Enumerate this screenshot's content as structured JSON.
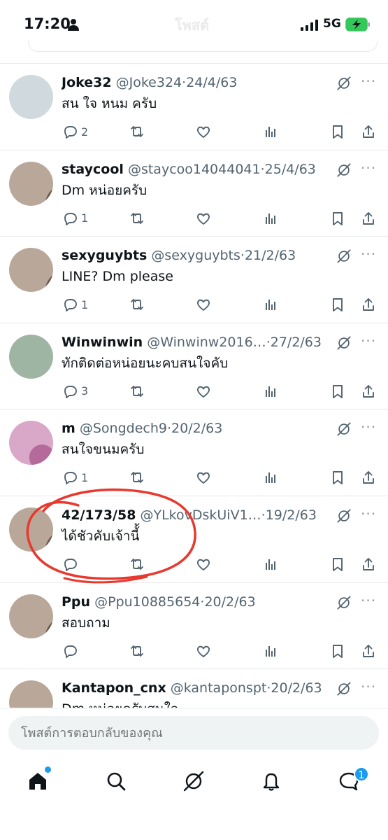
{
  "status_bar": {
    "time": "17:20",
    "network": "5G",
    "faded_title": "โพสต์"
  },
  "colors": {
    "accent": "#1d9bf0",
    "text": "#0f1419",
    "muted": "#536471",
    "annotation": "#e8392f",
    "battery": "#34c759"
  },
  "tweets": [
    {
      "name": "Joke32",
      "handle": "@Joke324",
      "date": "24/4/63",
      "text": "สน ใจ หนม ครับ",
      "replies": "2",
      "avatar": "default-avatar"
    },
    {
      "name": "staycool",
      "handle": "@staycoo14044041",
      "date": "25/4/63",
      "text": "Dm หน่อยครับ",
      "replies": "1",
      "avatar": "photo-avatar"
    },
    {
      "name": "sexyguybts",
      "handle": "@sexyguybts",
      "date": "21/2/63",
      "text": "LINE? Dm please",
      "replies": "1",
      "avatar": "photo-avatar"
    },
    {
      "name": "Winwinwin",
      "handle": "@Winwinw2016…",
      "date": "27/2/63",
      "text": "ทักติดต่อหน่อยนะคบสนใจคับ",
      "replies": "3",
      "avatar": "landscape-avatar"
    },
    {
      "name": "m",
      "handle": "@Songdech9",
      "date": "20/2/63",
      "text": "สนใจขนมครับ",
      "replies": "1",
      "avatar": "flower-avatar"
    },
    {
      "name": "42/173/58",
      "handle": "@YLkovDskUiV1…",
      "date": "19/2/63",
      "text": "ได้ชัวคับเจ้านี้้",
      "replies": "",
      "avatar": "photo-avatar"
    },
    {
      "name": "Ppu",
      "handle": "@Ppu10885654",
      "date": "20/2/63",
      "text": "สอบถาม",
      "replies": "",
      "avatar": "photo-avatar"
    },
    {
      "name": "Kantapon_cnx",
      "handle": "@kantaponspt",
      "date": "20/2/63",
      "text": "Dm หน่อยครับสนใจ",
      "replies": "",
      "avatar": "photo-avatar"
    }
  ],
  "separator": "·",
  "more_glyph": "···",
  "reply": {
    "placeholder": "โพสต์การตอบกลับของคุณ"
  },
  "tabbar": {
    "items": [
      "home-icon",
      "search-icon",
      "grok-icon",
      "notifications-icon",
      "messages-icon"
    ],
    "messages_badge": "1"
  }
}
